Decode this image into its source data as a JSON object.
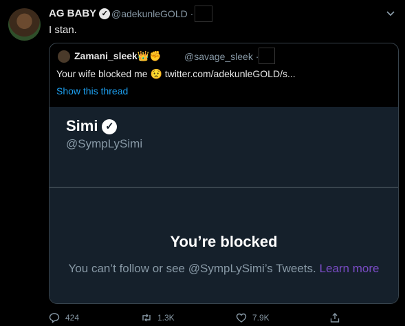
{
  "tweet": {
    "author_name": "AG BABY",
    "author_handle": "@adekunleGOLD",
    "separator": "·",
    "text": "I stan."
  },
  "quoted_tweet": {
    "author_name": "Zamani_sleek",
    "author_emojis": "👑✊",
    "author_handle": "@savage_sleek",
    "separator": "·",
    "text": "Your wife blocked me 😟  twitter.com/adekunleGOLD/s...",
    "show_thread": "Show this thread",
    "blocked_card": {
      "profile_name": "Simi",
      "profile_handle": "@SympLySimi",
      "title": "You’re blocked",
      "description": "You can’t follow or see @SympLySimi’s Tweets.",
      "link": "Learn more"
    }
  },
  "actions": {
    "replies": "424",
    "retweets": "1.3K",
    "likes": "7.9K"
  },
  "icons": [
    "verified-badge-icon",
    "chevron-down-icon",
    "reply-icon",
    "retweet-icon",
    "like-icon",
    "share-icon"
  ],
  "colors": {
    "background": "#000000",
    "card_background": "#15202b",
    "link_blue": "#1da1f2",
    "learn_more_purple": "#794bc4",
    "muted": "#8899a6"
  }
}
